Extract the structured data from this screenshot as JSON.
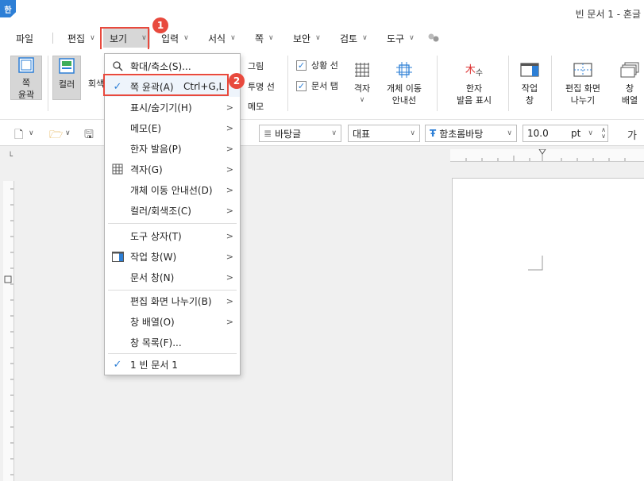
{
  "window": {
    "app_icon": "한",
    "title": "빈 문서 1 - 혼글"
  },
  "menubar": {
    "items": [
      {
        "label": "파일"
      },
      {
        "label": "편집"
      },
      {
        "label": "보기"
      },
      {
        "label": "입력"
      },
      {
        "label": "서식"
      },
      {
        "label": "쪽"
      },
      {
        "label": "보안"
      },
      {
        "label": "검토"
      },
      {
        "label": "도구"
      }
    ]
  },
  "ribbon": {
    "page_outline": "쪽\n윤곽",
    "color": "컬러",
    "gray": "회색",
    "picture": "그림",
    "transparent_line": "투명 선",
    "memo": "메모",
    "status_line": "상황 선",
    "doc_tab": "문서 탭",
    "grid": "격자",
    "object_guide": "개체 이동\n안내선",
    "hanja": "한자\n발음 표시",
    "task_pane": "작업\n창",
    "split": "편집 화면\n나누기",
    "window_arrange": "창\n배열"
  },
  "toolbar": {
    "style": "바탕글",
    "lang": "대표",
    "font": "함초롬바탕",
    "size": "10.0",
    "unit": "pt",
    "bold_glyph": "가"
  },
  "dropdown": {
    "items": [
      {
        "label": "확대/축소(S)..."
      },
      {
        "label": "쪽 윤곽(A)",
        "shortcut": "Ctrl+G,L"
      },
      {
        "label": "표시/숨기기(H)"
      },
      {
        "label": "메모(E)"
      },
      {
        "label": "한자 발음(P)"
      },
      {
        "label": "격자(G)"
      },
      {
        "label": "개체 이동 안내선(D)"
      },
      {
        "label": "컬러/회색조(C)"
      },
      {
        "label": "도구 상자(T)"
      },
      {
        "label": "작업 창(W)"
      },
      {
        "label": "문서 창(N)"
      },
      {
        "label": "편집 화면 나누기(B)"
      },
      {
        "label": "창 배열(O)"
      },
      {
        "label": "창 목록(F)..."
      },
      {
        "label": "1 빈 문서 1"
      }
    ]
  },
  "annotations": {
    "badge1": "1",
    "badge2": "2"
  },
  "colors": {
    "accent": "#2d7fd6",
    "highlight": "#e8493d"
  }
}
